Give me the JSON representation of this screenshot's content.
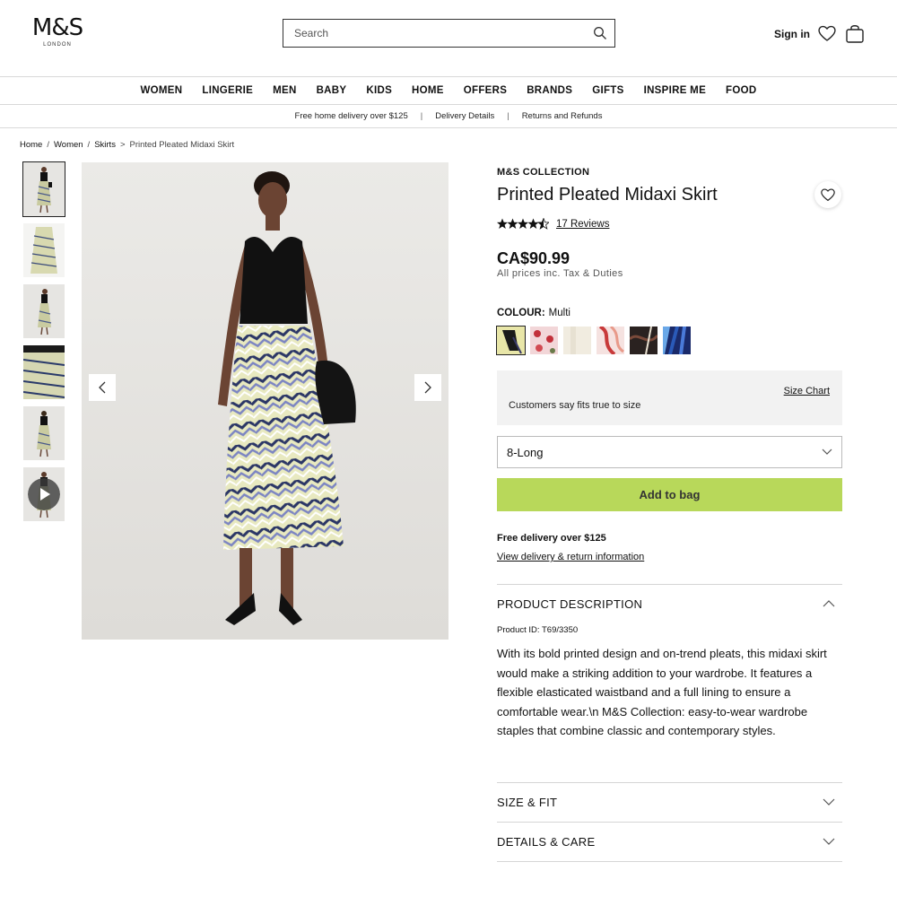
{
  "header": {
    "logo_main": "M&S",
    "logo_sub": "LONDON",
    "search_placeholder": "Search",
    "sign_in": "Sign in"
  },
  "nav": [
    "WOMEN",
    "LINGERIE",
    "MEN",
    "BABY",
    "KIDS",
    "HOME",
    "OFFERS",
    "BRANDS",
    "GIFTS",
    "INSPIRE ME",
    "FOOD"
  ],
  "promo": {
    "free_delivery": "Free home delivery over $125",
    "delivery_details": "Delivery Details",
    "returns": "Returns and Refunds"
  },
  "breadcrumb": {
    "home": "Home",
    "women": "Women",
    "skirts": "Skirts",
    "current": "Printed Pleated Midaxi Skirt"
  },
  "product": {
    "brand": "M&S COLLECTION",
    "title": "Printed Pleated Midaxi Skirt",
    "rating": 4.5,
    "reviews": "17 Reviews",
    "price": "CA$90.99",
    "price_note": "All prices inc. Tax & Duties",
    "colour_label": "COLOUR:",
    "colour_value": "Multi",
    "size_chart": "Size Chart",
    "fit_text": "Customers say fits true to size",
    "size_value": "8-Long",
    "add_to_bag": "Add to bag",
    "free_delivery": "Free delivery over $125",
    "view_delivery": "View delivery & return information"
  },
  "accordions": {
    "description_title": "PRODUCT DESCRIPTION",
    "product_id": "Product ID: T69/3350",
    "description": "With its bold printed design and on-trend pleats, this midaxi skirt would make a striking addition to your wardrobe. It features a flexible elasticated waistband and a full lining to ensure a comfortable wear.\\n M&S Collection: easy-to-wear wardrobe staples that combine classic and contemporary styles.",
    "size_fit": "SIZE & FIT",
    "details_care": "DETAILS & CARE"
  },
  "colors": {
    "add_to_bag_bg": "#b8d85a",
    "swatches": [
      "#e8e6a8",
      "#e8b0b8",
      "#f1ece0",
      "#e3a4a4",
      "#2a2220",
      "#2a4a9a"
    ]
  }
}
